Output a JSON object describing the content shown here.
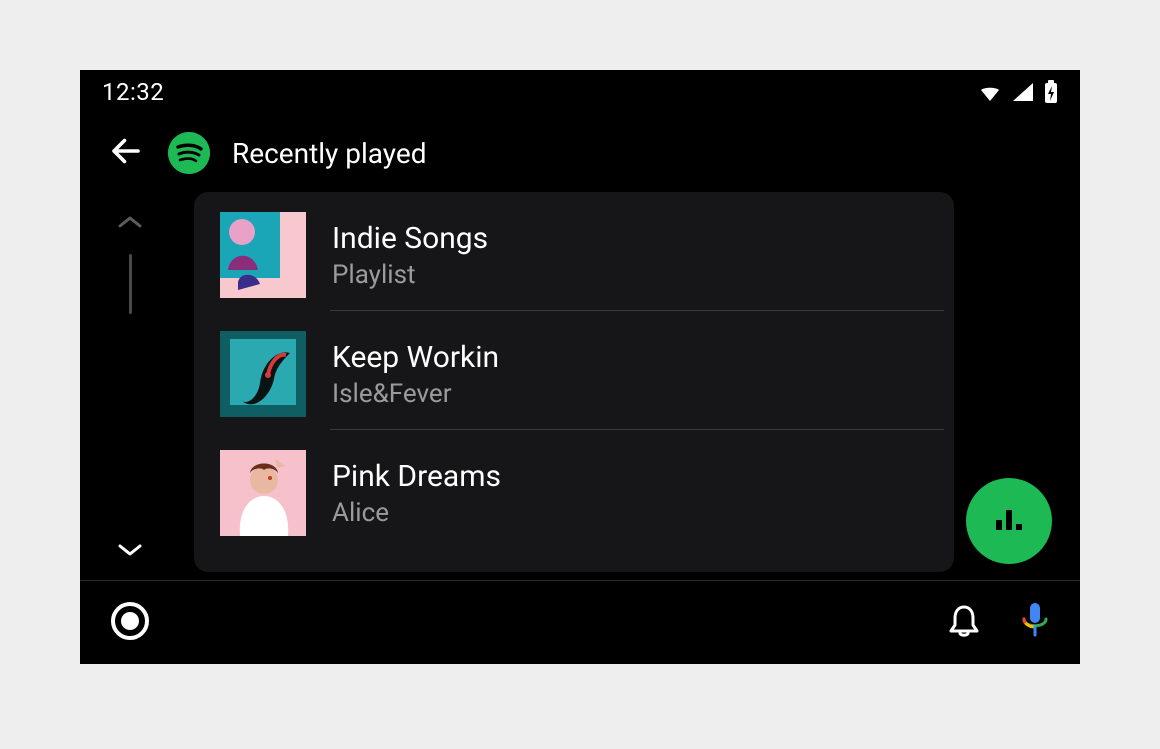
{
  "status": {
    "clock": "12:32"
  },
  "header": {
    "title": "Recently played"
  },
  "list": {
    "items": [
      {
        "title": "Indie Songs",
        "subtitle": "Playlist"
      },
      {
        "title": "Keep Workin",
        "subtitle": "Isle&Fever"
      },
      {
        "title": "Pink Dreams",
        "subtitle": "Alice"
      }
    ]
  },
  "icons": {
    "back": "back-arrow-icon",
    "spotify": "spotify-logo-icon",
    "scroll_up": "chevron-up-icon",
    "scroll_down": "chevron-down-icon",
    "fab": "equalizer-icon",
    "launcher": "app-launcher-icon",
    "bell": "bell-icon",
    "mic": "mic-icon",
    "wifi": "wifi-icon",
    "cell": "cellular-icon",
    "battery": "battery-charging-icon"
  },
  "colors": {
    "accent": "#1db954",
    "bg_page": "#eeeeee",
    "bg_device": "#000000",
    "bg_panel": "#161618",
    "text_primary": "#ffffff",
    "text_secondary": "#9b9b9b"
  }
}
